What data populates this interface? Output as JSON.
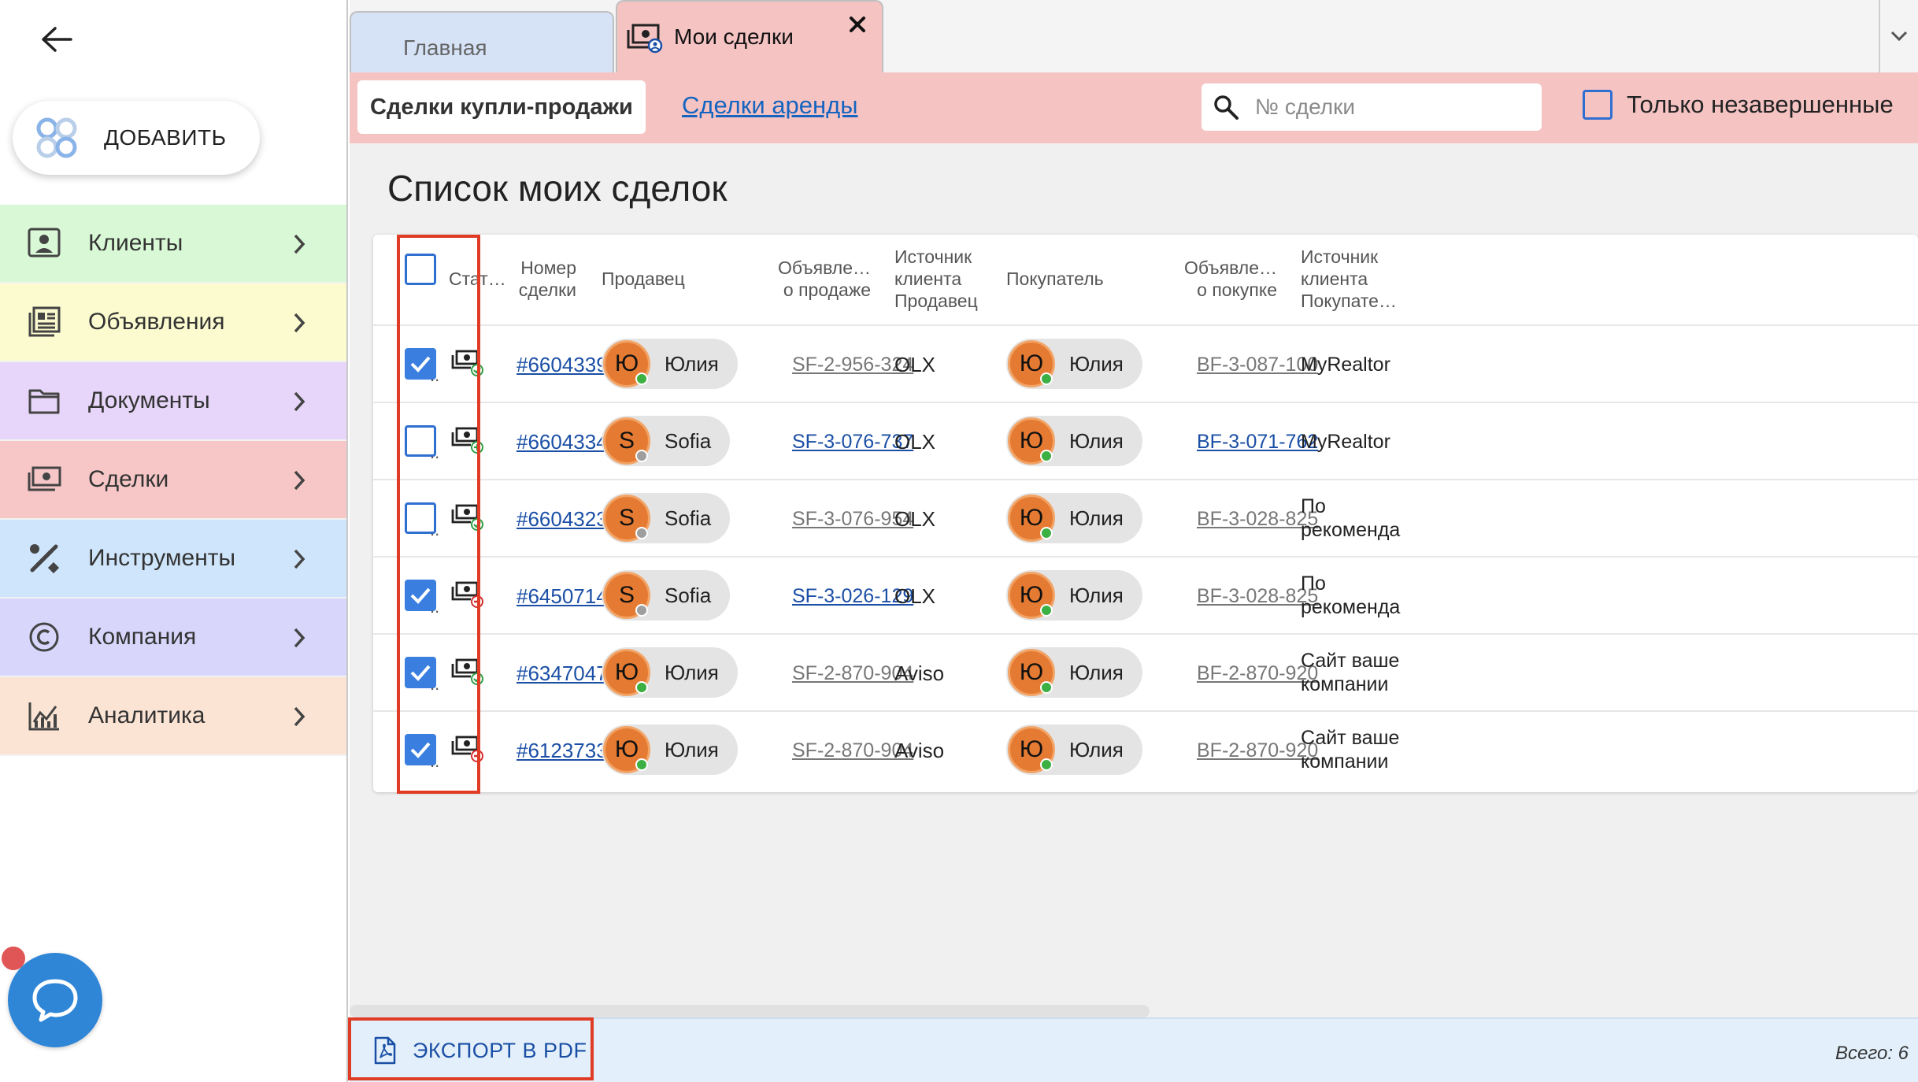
{
  "sidebar": {
    "add_label": "ДОБАВИТЬ",
    "items": [
      {
        "label": "Клиенты",
        "color": "#d9f9d6"
      },
      {
        "label": "Объявления",
        "color": "#fbfbcf"
      },
      {
        "label": "Документы",
        "color": "#e7d6f9"
      },
      {
        "label": "Сделки",
        "color": "#f7c7c7"
      },
      {
        "label": "Инструменты",
        "color": "#cfe5fb"
      },
      {
        "label": "Компания",
        "color": "#d8d6fb"
      },
      {
        "label": "Аналитика",
        "color": "#fbe4d4"
      }
    ]
  },
  "tabs": {
    "home": "Главная",
    "deals": "Мои сделки",
    "close_glyph": "×"
  },
  "subnav": {
    "sale": "Сделки купли-продажи",
    "rent": "Сделки аренды",
    "search_placeholder": "№ сделки",
    "only_open": "Только незавершенные"
  },
  "page_title": "Список моих сделок",
  "table": {
    "headers": {
      "status": "Стат…",
      "number_l1": "Номер",
      "number_l2": "сделки",
      "seller": "Продавец",
      "sale_ad_l1": "Объявле…",
      "sale_ad_l2": "о продаже",
      "seller_src_l1": "Источник",
      "seller_src_l2": "клиента",
      "seller_src_l3": "Продавец",
      "buyer": "Покупатель",
      "buy_ad_l1": "Объявле…",
      "buy_ad_l2": "о покупке",
      "buyer_src_l1": "Источник",
      "buyer_src_l2": "клиента",
      "buyer_src_l3": "Покупате…"
    },
    "rows": [
      {
        "checked": true,
        "status": "completed",
        "number": "#6604339",
        "seller_initial": "Ю",
        "seller": "Юлия",
        "seller_online": true,
        "sale_ad": "SF-2-956-324",
        "sale_ad_active": false,
        "seller_src": "OLX",
        "buyer_initial": "Ю",
        "buyer": "Юлия",
        "buyer_online": true,
        "buy_ad": "BF-3-087-100",
        "buy_ad_active": false,
        "buyer_src_l1": "MyRealtor",
        "buyer_src_l2": ""
      },
      {
        "checked": false,
        "status": "new",
        "number": "#6604334",
        "seller_initial": "S",
        "seller": "Sofia",
        "seller_online": false,
        "sale_ad": "SF-3-076-737",
        "sale_ad_active": true,
        "seller_src": "OLX",
        "buyer_initial": "Ю",
        "buyer": "Юлия",
        "buyer_online": true,
        "buy_ad": "BF-3-071-762",
        "buy_ad_active": true,
        "buyer_src_l1": "MyRealtor",
        "buyer_src_l2": ""
      },
      {
        "checked": false,
        "status": "completed",
        "number": "#6604323",
        "seller_initial": "S",
        "seller": "Sofia",
        "seller_online": false,
        "sale_ad": "SF-3-076-954",
        "sale_ad_active": false,
        "seller_src": "OLX",
        "buyer_initial": "Ю",
        "buyer": "Юлия",
        "buyer_online": true,
        "buy_ad": "BF-3-028-825",
        "buy_ad_active": false,
        "buyer_src_l1": "По",
        "buyer_src_l2": "рекоменда"
      },
      {
        "checked": true,
        "status": "cancelled",
        "number": "#6450714",
        "seller_initial": "S",
        "seller": "Sofia",
        "seller_online": false,
        "sale_ad": "SF-3-026-129",
        "sale_ad_active": true,
        "seller_src": "OLX",
        "buyer_initial": "Ю",
        "buyer": "Юлия",
        "buyer_online": true,
        "buy_ad": "BF-3-028-825",
        "buy_ad_active": false,
        "buyer_src_l1": "По",
        "buyer_src_l2": "рекоменда"
      },
      {
        "checked": true,
        "status": "completed",
        "number": "#6347047",
        "seller_initial": "Ю",
        "seller": "Юлия",
        "seller_online": true,
        "sale_ad": "SF-2-870-904",
        "sale_ad_active": false,
        "seller_src": "Aviso",
        "buyer_initial": "Ю",
        "buyer": "Юлия",
        "buyer_online": true,
        "buy_ad": "BF-2-870-920",
        "buy_ad_active": false,
        "buyer_src_l1": "Сайт ваше",
        "buyer_src_l2": "компании"
      },
      {
        "checked": true,
        "status": "cancelled",
        "number": "#6123733",
        "seller_initial": "Ю",
        "seller": "Юлия",
        "seller_online": true,
        "sale_ad": "SF-2-870-904",
        "sale_ad_active": false,
        "seller_src": "Aviso",
        "buyer_initial": "Ю",
        "buyer": "Юлия",
        "buyer_online": true,
        "buy_ad": "BF-2-870-920",
        "buy_ad_active": false,
        "buyer_src_l1": "Сайт ваше",
        "buyer_src_l2": "компании"
      }
    ],
    "dots": ".."
  },
  "footer": {
    "export_label": "ЭКСПОРТ В PDF",
    "total": "Всего: 6"
  },
  "colors": {
    "accent_blue": "#3a7fe0",
    "link_blue": "#1b4fa5",
    "deals_pink": "#f6c3c3",
    "avatar_orange": "#e57b33",
    "online_green": "#3cb043",
    "offline_grey": "#9e9e9e",
    "status_green": "#2e9e44",
    "status_red": "#d32f2f",
    "highlight_red": "#e03b24"
  },
  "icons": {
    "back": "arrow-left-icon",
    "add": "dots-logo-icon",
    "search": "search-icon",
    "chevron": "chevron-right-icon",
    "chat": "chat-bubble-icon",
    "pdf": "pdf-file-icon"
  }
}
